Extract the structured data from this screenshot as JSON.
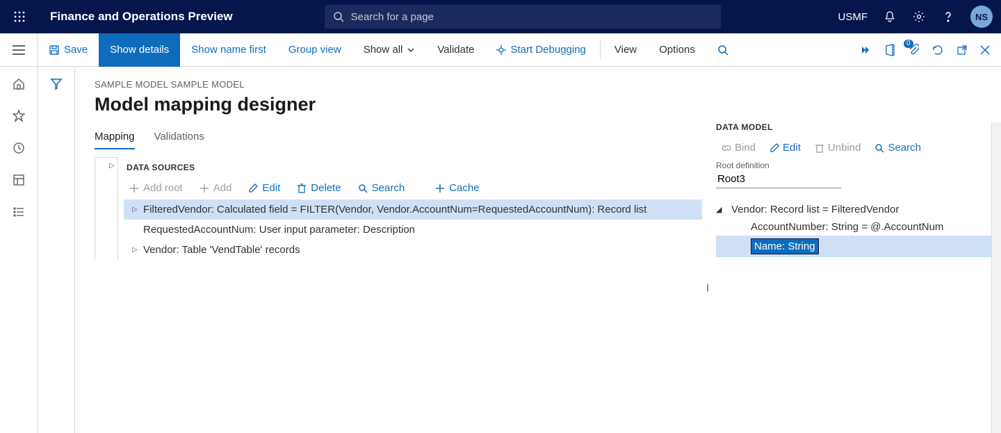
{
  "topbar": {
    "title": "Finance and Operations Preview",
    "search_placeholder": "Search for a page",
    "company": "USMF",
    "avatar": "NS"
  },
  "cmdbar": {
    "save": "Save",
    "show_details": "Show details",
    "show_name_first": "Show name first",
    "group_view": "Group view",
    "show_all": "Show all",
    "validate": "Validate",
    "start_debug": "Start Debugging",
    "view": "View",
    "options": "Options",
    "badge": "0"
  },
  "page": {
    "crumb": "SAMPLE MODEL SAMPLE MODEL",
    "title": "Model mapping designer"
  },
  "tabs": {
    "mapping": "Mapping",
    "validations": "Validations"
  },
  "ds": {
    "header": "DATA SOURCES",
    "add_root": "Add root",
    "add": "Add",
    "edit": "Edit",
    "delete": "Delete",
    "search": "Search",
    "cache": "Cache",
    "row1": "FilteredVendor: Calculated field = FILTER(Vendor, Vendor.AccountNum=RequestedAccountNum): Record list",
    "row2": "RequestedAccountNum: User input parameter: Description",
    "row3": "Vendor: Table 'VendTable' records"
  },
  "dm": {
    "header": "DATA MODEL",
    "bind": "Bind",
    "edit": "Edit",
    "unbind": "Unbind",
    "search": "Search",
    "root_label": "Root definition",
    "root_value": "Root3",
    "n1": "Vendor: Record list = FilteredVendor",
    "n2": "AccountNumber: String = @.AccountNum",
    "n3": "Name: String"
  }
}
